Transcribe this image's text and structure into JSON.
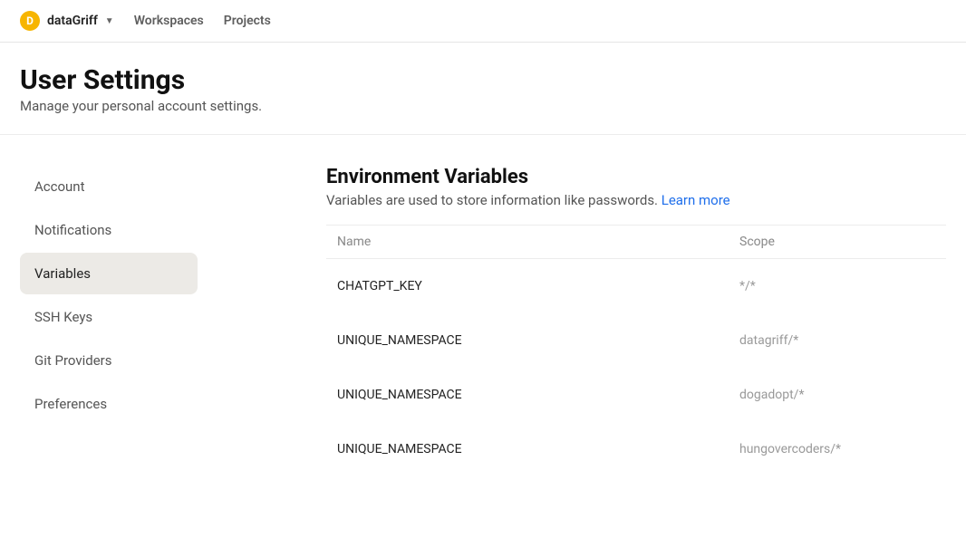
{
  "topnav": {
    "org": {
      "avatar_letter": "D",
      "name": "dataGriff"
    },
    "links": {
      "workspaces": "Workspaces",
      "projects": "Projects"
    }
  },
  "header": {
    "title": "User Settings",
    "subtitle": "Manage your personal account settings."
  },
  "sidebar": {
    "items": [
      {
        "label": "Account"
      },
      {
        "label": "Notifications"
      },
      {
        "label": "Variables"
      },
      {
        "label": "SSH Keys"
      },
      {
        "label": "Git Providers"
      },
      {
        "label": "Preferences"
      }
    ]
  },
  "main": {
    "section_title": "Environment Variables",
    "section_desc": "Variables are used to store information like passwords. ",
    "learn_more": "Learn more",
    "table": {
      "headers": {
        "name": "Name",
        "scope": "Scope"
      },
      "rows": [
        {
          "name": "CHATGPT_KEY",
          "scope": "*/*"
        },
        {
          "name": "UNIQUE_NAMESPACE",
          "scope": "datagriff/*"
        },
        {
          "name": "UNIQUE_NAMESPACE",
          "scope": "dogadopt/*"
        },
        {
          "name": "UNIQUE_NAMESPACE",
          "scope": "hungovercoders/*"
        }
      ]
    }
  }
}
